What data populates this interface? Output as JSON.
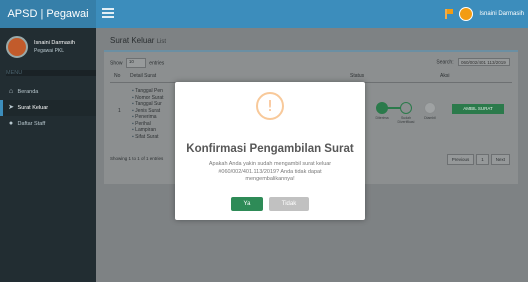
{
  "header": {
    "logo": "APSD | Pegawai",
    "user_name": "Isnaini Darmasih"
  },
  "sidebar": {
    "user_name": "Isnaini Darmasih",
    "user_status": "Pegawai PKL",
    "menu_header": "MENU",
    "items": [
      {
        "label": "Beranda",
        "icon": "home-icon"
      },
      {
        "label": "Surat Keluar",
        "icon": "send-icon"
      },
      {
        "label": "Daftar Staff",
        "icon": "users-icon"
      }
    ]
  },
  "main": {
    "title": "Surat Keluar",
    "subtitle": "List",
    "show_label": "Show",
    "entries_value": "10",
    "entries_label": "entries",
    "search_label": "Search:",
    "search_value": "060/002/401 113/2019",
    "columns": [
      "No",
      "Detail Surat",
      "Status",
      "Aksi"
    ],
    "row": {
      "no": "1",
      "details": [
        "Tanggal Pen",
        "Nomor Surat",
        "Tanggal Sur",
        "Jenis Surat",
        "Penerima",
        "Perihal",
        "Lampiran",
        "Sifat Surat"
      ],
      "steps": [
        "Diterima",
        "Sudah Diverifikasi",
        "Diambil"
      ],
      "action_button": "AMBIL SURAT"
    },
    "footer_info": "Showing 1 to 1 of 1 entries",
    "pager": [
      "Previous",
      "1",
      "Next"
    ]
  },
  "modal": {
    "icon": "warning-icon",
    "title": "Konfirmasi Pengambilan Surat",
    "message": "Apakah Anda yakin sudah mengambil surat keluar #060/002/401.113/2019? Anda tidak dapat mengembalikannya!",
    "confirm_label": "Ya",
    "cancel_label": "Tidak"
  }
}
